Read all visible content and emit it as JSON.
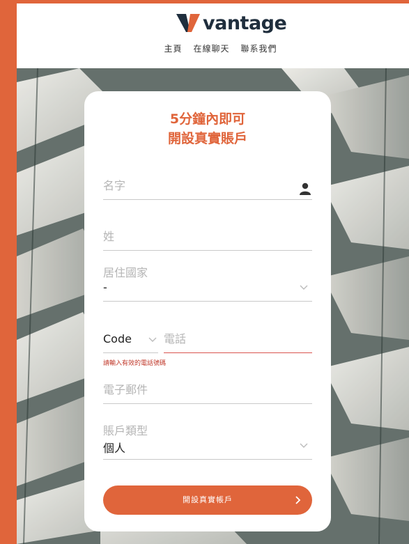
{
  "colors": {
    "accent": "#e0653b",
    "logo_dark": "#1f2e3d",
    "error": "#c0392b"
  },
  "header": {
    "logo_text": "vantage",
    "nav": [
      "主頁",
      "在線聊天",
      "聯系我們"
    ]
  },
  "form": {
    "title_line1": "5分鐘內即可",
    "title_line2": "開設真實賬戶",
    "first_name": {
      "placeholder": "名字",
      "icon": "person-icon"
    },
    "last_name": {
      "placeholder": "姓"
    },
    "country": {
      "label": "居住國家",
      "value": "-"
    },
    "phone": {
      "code_label": "Code",
      "placeholder": "電話",
      "error": "請輸入有效的電話號碼"
    },
    "email": {
      "placeholder": "電子郵件"
    },
    "account_type": {
      "label": "賬戶類型",
      "value": "個人"
    },
    "submit_label": "開設真實帳戶"
  }
}
